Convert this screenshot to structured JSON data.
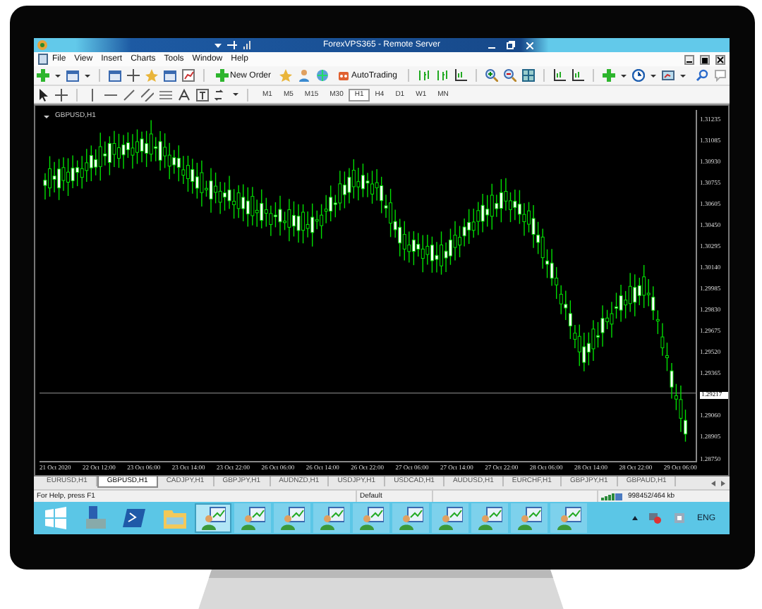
{
  "window": {
    "title": "ForexVPS365 - Remote Server"
  },
  "menu": [
    "File",
    "View",
    "Insert",
    "Charts",
    "Tools",
    "Window",
    "Help"
  ],
  "toolbar": {
    "buttons": [
      {
        "label": "New Order"
      },
      {
        "label": "AutoTrading"
      }
    ]
  },
  "timeframes": [
    {
      "label": "M1",
      "selected": false
    },
    {
      "label": "M5",
      "selected": false
    },
    {
      "label": "M15",
      "selected": false
    },
    {
      "label": "M30",
      "selected": false
    },
    {
      "label": "H1",
      "selected": true
    },
    {
      "label": "H4",
      "selected": false
    },
    {
      "label": "D1",
      "selected": false
    },
    {
      "label": "W1",
      "selected": false
    },
    {
      "label": "MN",
      "selected": false
    }
  ],
  "chart": {
    "symbol": "GBPUSD,H1",
    "price_labels": [
      {
        "text": "1.31235",
        "kind": "tick"
      },
      {
        "text": "1.31085",
        "kind": "tick"
      },
      {
        "text": "1.30930",
        "kind": "tick"
      },
      {
        "text": "1.30755",
        "kind": "tick"
      },
      {
        "text": "1.30605",
        "kind": "tick"
      },
      {
        "text": "1.30450",
        "kind": "tick"
      },
      {
        "text": "1.30295",
        "kind": "tick"
      },
      {
        "text": "1.30140",
        "kind": "tick"
      },
      {
        "text": "1.29985",
        "kind": "tick"
      },
      {
        "text": "1.29830",
        "kind": "tick"
      },
      {
        "text": "1.29675",
        "kind": "tick"
      },
      {
        "text": "1.29520",
        "kind": "tick"
      },
      {
        "text": "1.29365",
        "kind": "tick"
      },
      {
        "text": "1.29217",
        "kind": "current"
      },
      {
        "text": "1.29060",
        "kind": "tick"
      },
      {
        "text": "1.28905",
        "kind": "tick"
      },
      {
        "text": "1.28750",
        "kind": "tick"
      }
    ],
    "time_labels": [
      "21 Oct 2020",
      "22 Oct 12:00",
      "23 Oct 06:00",
      "23 Oct 14:00",
      "23 Oct 22:00",
      "26 Oct 06:00",
      "26 Oct 14:00",
      "26 Oct 22:00",
      "27 Oct 06:00",
      "27 Oct 14:00",
      "27 Oct 22:00",
      "28 Oct 06:00",
      "28 Oct 14:00",
      "28 Oct 22:00",
      "29 Oct 06:00"
    ]
  },
  "symbol_tabs": [
    {
      "label": "EURUSD,H1",
      "selected": false
    },
    {
      "label": "GBPUSD,H1",
      "selected": true
    },
    {
      "label": "CADJPY,H1",
      "selected": false
    },
    {
      "label": "GBPJPY,H1",
      "selected": false
    },
    {
      "label": "AUDNZD,H1",
      "selected": false
    },
    {
      "label": "USDJPY,H1",
      "selected": false
    },
    {
      "label": "USDCAD,H1",
      "selected": false
    },
    {
      "label": "AUDUSD,H1",
      "selected": false
    },
    {
      "label": "EURCHF,H1",
      "selected": false
    },
    {
      "label": "GBPJPY,H1",
      "selected": false
    },
    {
      "label": "GBPAUD,H1",
      "selected": false
    }
  ],
  "status_bar": {
    "help": "For Help, press F1",
    "profile": "Default",
    "traffic": "998452/464 kb"
  },
  "taskbar": {
    "apps": [
      {
        "kind": "start",
        "active": false
      },
      {
        "kind": "server",
        "active": false
      },
      {
        "kind": "shell",
        "active": false
      },
      {
        "kind": "folder",
        "active": false
      },
      {
        "kind": "terminal",
        "active": true
      },
      {
        "kind": "terminal",
        "active": false
      },
      {
        "kind": "terminal",
        "active": false
      },
      {
        "kind": "terminal",
        "active": false
      },
      {
        "kind": "terminal",
        "active": false
      },
      {
        "kind": "terminal",
        "active": false
      },
      {
        "kind": "terminal",
        "active": false
      },
      {
        "kind": "terminal",
        "active": false
      },
      {
        "kind": "terminal",
        "active": false
      },
      {
        "kind": "terminal",
        "active": false
      }
    ],
    "language": "ENG"
  }
}
